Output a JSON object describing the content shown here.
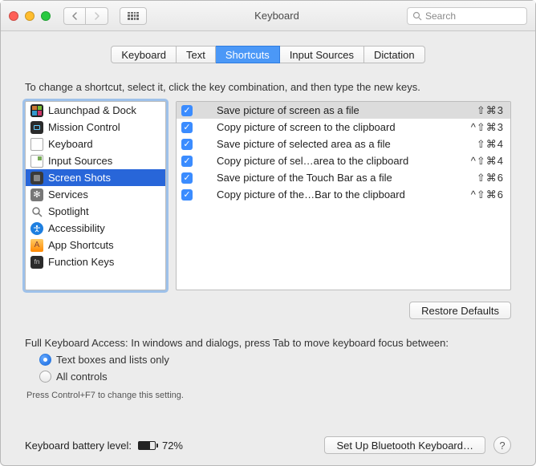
{
  "titlebar": {
    "title": "Keyboard",
    "search_placeholder": "Search"
  },
  "tabs": [
    "Keyboard",
    "Text",
    "Shortcuts",
    "Input Sources",
    "Dictation"
  ],
  "active_tab": 2,
  "instruction": "To change a shortcut, select it, click the key combination, and then type the new keys.",
  "categories": [
    {
      "label": "Launchpad & Dock",
      "icon": "launchpad"
    },
    {
      "label": "Mission Control",
      "icon": "mission"
    },
    {
      "label": "Keyboard",
      "icon": "keyboard"
    },
    {
      "label": "Input Sources",
      "icon": "input"
    },
    {
      "label": "Screen Shots",
      "icon": "screenshots"
    },
    {
      "label": "Services",
      "icon": "services"
    },
    {
      "label": "Spotlight",
      "icon": "spotlight"
    },
    {
      "label": "Accessibility",
      "icon": "accessibility"
    },
    {
      "label": "App Shortcuts",
      "icon": "appshortcuts"
    },
    {
      "label": "Function Keys",
      "icon": "fn"
    }
  ],
  "selected_category": 4,
  "shortcuts": [
    {
      "label": "Save picture of screen as a file",
      "keys": "⇧⌘3"
    },
    {
      "label": "Copy picture of screen to the clipboard",
      "keys": "^⇧⌘3"
    },
    {
      "label": "Save picture of selected area as a file",
      "keys": "⇧⌘4"
    },
    {
      "label": "Copy picture of sel…area to the clipboard",
      "keys": "^⇧⌘4"
    },
    {
      "label": "Save picture of the Touch Bar as a file",
      "keys": "⇧⌘6"
    },
    {
      "label": "Copy picture of the…Bar to the clipboard",
      "keys": "^⇧⌘6"
    }
  ],
  "selected_shortcut": 0,
  "restore_label": "Restore Defaults",
  "fka": {
    "heading": "Full Keyboard Access: In windows and dialogs, press Tab to move keyboard focus between:",
    "opt1": "Text boxes and lists only",
    "opt2": "All controls",
    "hint": "Press Control+F7 to change this setting."
  },
  "footer": {
    "battery_label": "Keyboard battery level:",
    "battery_pct": "72%",
    "bluetooth_btn": "Set Up Bluetooth Keyboard…"
  }
}
